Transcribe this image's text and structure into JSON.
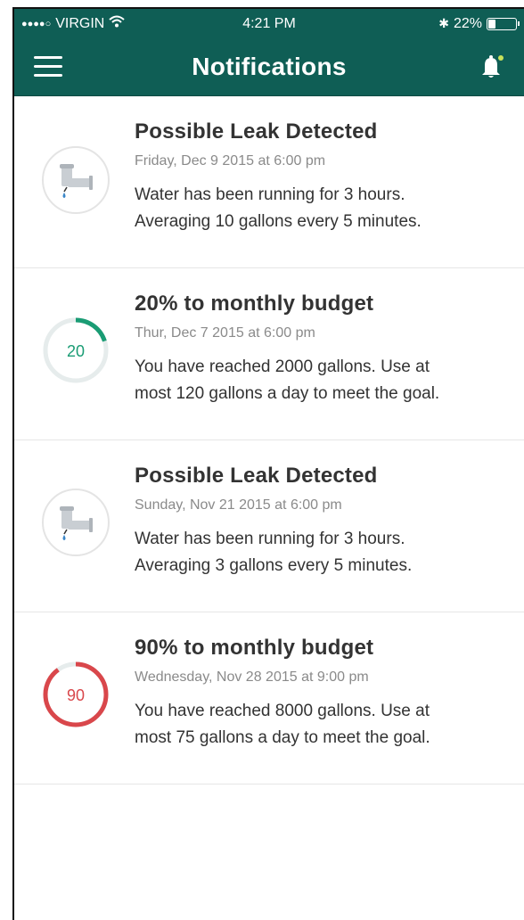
{
  "status_bar": {
    "signal": "●●●●○",
    "carrier": "VIRGIN",
    "wifi": "wifi-icon",
    "time": "4:21 PM",
    "bluetooth": "✱",
    "battery_pct": "22%",
    "battery_level": 0.22
  },
  "nav": {
    "title": "Notifications",
    "accent": "#0f5e55",
    "bell_dot_color": "#c8e25a"
  },
  "notifications": [
    {
      "type": "leak",
      "icon": "faucet-leak-icon",
      "title": "Possible Leak Detected",
      "date": "Friday, Dec 9 2015 at 6:00 pm",
      "body_line1": "Water has been running for 3 hours.",
      "body_line2": "Averaging 10 gallons every 5 minutes."
    },
    {
      "type": "budget",
      "ring_value": "20",
      "ring_percent": 20,
      "ring_color": "#1a9c74",
      "title": "20% to monthly budget",
      "date": "Thur, Dec 7 2015 at 6:00 pm",
      "body_line1": "You have reached 2000 gallons. Use at",
      "body_line2": "most 120 gallons a day to meet the goal."
    },
    {
      "type": "leak",
      "icon": "faucet-leak-icon",
      "title": "Possible Leak Detected",
      "date": "Sunday, Nov 21 2015 at 6:00 pm",
      "body_line1": "Water has been running for 3 hours.",
      "body_line2": "Averaging 3 gallons every 5 minutes."
    },
    {
      "type": "budget",
      "ring_value": "90",
      "ring_percent": 90,
      "ring_color": "#d9474b",
      "title": "90% to monthly budget",
      "date": "Wednesday, Nov 28 2015 at 9:00 pm",
      "body_line1": "You have reached 8000 gallons. Use at",
      "body_line2": "most 75 gallons a day to meet the goal."
    }
  ]
}
